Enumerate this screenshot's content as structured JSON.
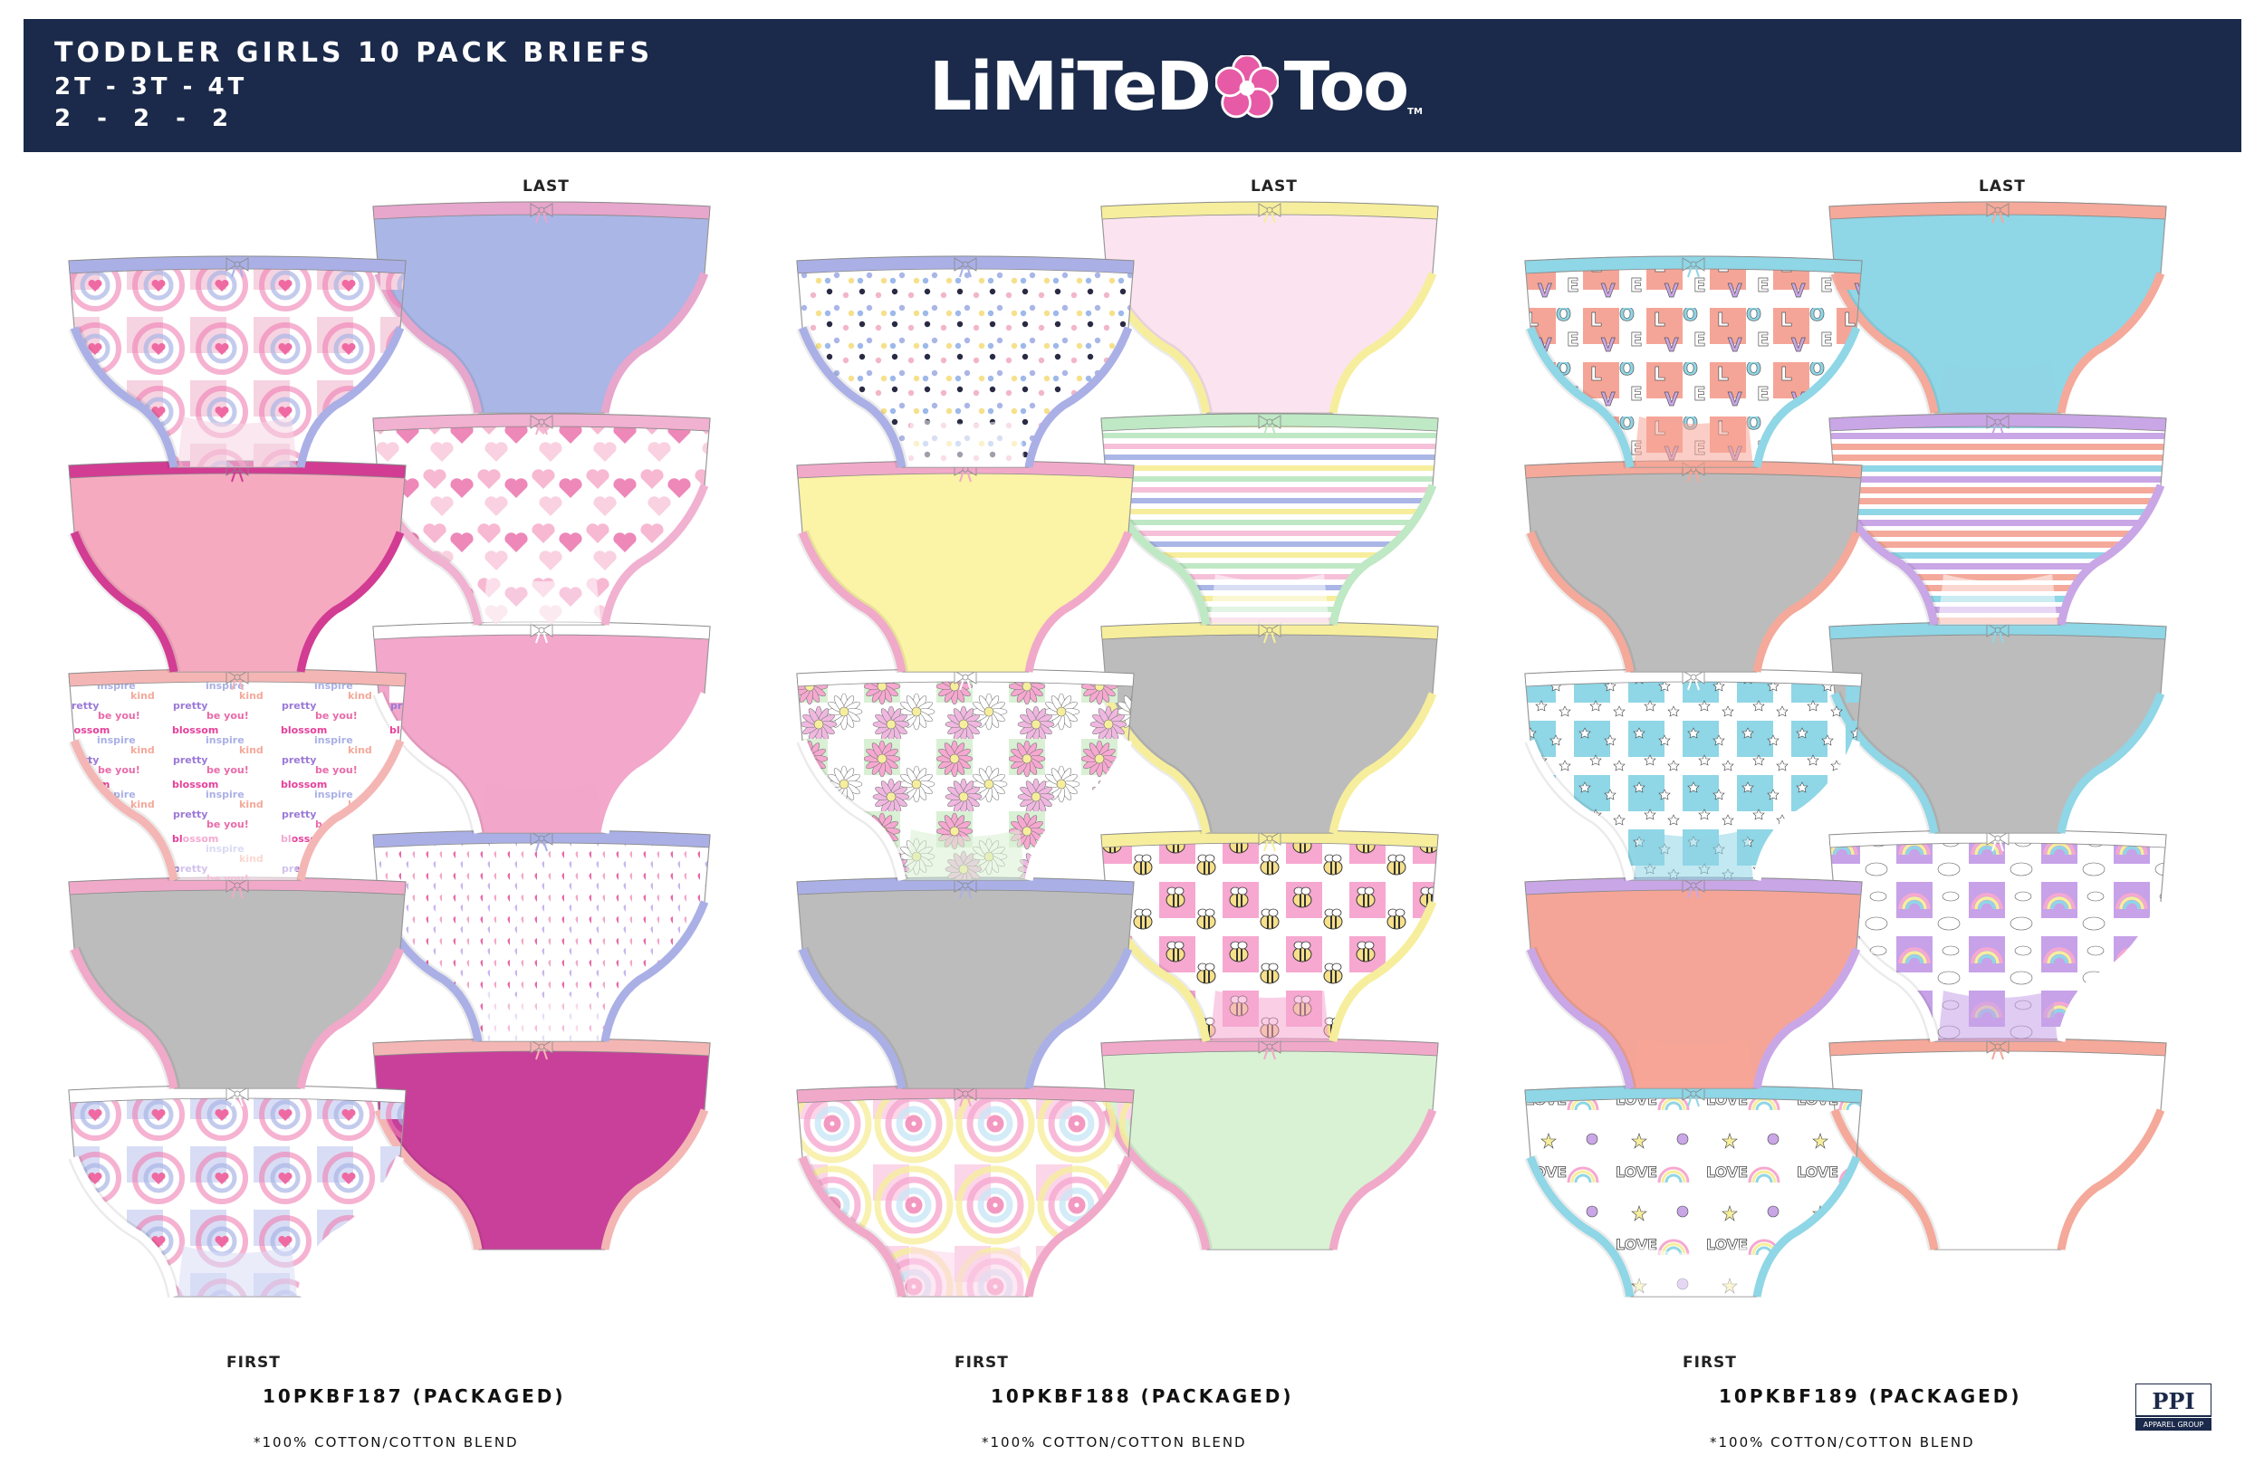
{
  "header": {
    "title": "TODDLER GIRLS 10 PACK BRIEFS",
    "sizes": "2T - 3T - 4T",
    "quantities": "2 - 2 - 2",
    "background_color": "#1b2a4a"
  },
  "logo": {
    "part1": "LiMiTeD",
    "part2": "Too",
    "mark": "TM",
    "flower_color": "#e65aa6"
  },
  "columns": [
    {
      "last_label": "LAST",
      "first_label": "FIRST",
      "sku": "10PKBF187 (PACKAGED)",
      "fabric_note": "*100% COTTON/COTTON BLEND"
    },
    {
      "last_label": "LAST",
      "first_label": "FIRST",
      "sku": "10PKBF188 (PACKAGED)",
      "fabric_note": "*100% COTTON/COTTON BLEND"
    },
    {
      "last_label": "LAST",
      "first_label": "FIRST",
      "sku": "10PKBF189 (PACKAGED)",
      "fabric_note": "*100% COTTON/COTTON BLEND"
    }
  ],
  "print_text_words": [
    "blossom",
    "inspire",
    "kind",
    "pretty",
    "be you!"
  ],
  "love_print_word": "LOVE",
  "briefs": [
    [
      {
        "pattern": "tiedye-hearts",
        "body": "#f6d3e1",
        "trim": "#aab0e6",
        "bow": "#aab0e6"
      },
      {
        "pattern": "solid",
        "body": "#aab6e6",
        "trim": "#e7a6cc",
        "bow": "#e7a6cc"
      },
      {
        "pattern": "solid",
        "body": "#f6aabf",
        "trim": "#d23c93",
        "bow": "#d23c93"
      },
      {
        "pattern": "scribble-hearts",
        "body": "#ffffff",
        "trim": "#f1b1d0",
        "bow": "#f1b1d0"
      },
      {
        "pattern": "text-print",
        "body": "#ffffff",
        "trim": "#f4b6b4",
        "bow": "#f4b6b4"
      },
      {
        "pattern": "solid",
        "body": "#f2a7cb",
        "trim": "#ffffff",
        "bow": "#ffffff"
      },
      {
        "pattern": "solid",
        "body": "#bcbcbc",
        "trim": "#f1a9c9",
        "bow": "#f1a9c9"
      },
      {
        "pattern": "small-hearts",
        "body": "#ffffff",
        "trim": "#aab0e6",
        "bow": "#aab0e6"
      },
      {
        "pattern": "tiedye-hearts",
        "body": "#d8ddf5",
        "trim": "#ffffff",
        "bow": "#ffffff"
      },
      {
        "pattern": "solid",
        "body": "#c9409a",
        "trim": "#f4b6b4",
        "bow": "#f4b6b4"
      }
    ],
    [
      {
        "pattern": "dots",
        "body": "#ffffff",
        "trim": "#aab0e6",
        "bow": "#aab0e6"
      },
      {
        "pattern": "solid",
        "body": "#fbe3ef",
        "trim": "#f6ee9c",
        "bow": "#f6ee9c"
      },
      {
        "pattern": "solid",
        "body": "#fbf3a6",
        "trim": "#f1a9c9",
        "bow": "#f1a9c9"
      },
      {
        "pattern": "stripes-pastel",
        "body": "#ffffff",
        "trim": "#bfe8c4",
        "bow": "#bfe8c4"
      },
      {
        "pattern": "daisies",
        "body": "#d9f0d4",
        "trim": "#ffffff",
        "bow": "#ffffff"
      },
      {
        "pattern": "solid",
        "body": "#bcbcbc",
        "trim": "#f6ee9c",
        "bow": "#f6ee9c"
      },
      {
        "pattern": "solid",
        "body": "#bcbcbc",
        "trim": "#aab0e6",
        "bow": "#aab0e6"
      },
      {
        "pattern": "bees",
        "body": "#f6a8d0",
        "trim": "#f6ee9c",
        "bow": "#f6ee9c"
      },
      {
        "pattern": "tiedye",
        "body": "#fbd6e9",
        "trim": "#f1a9c9",
        "bow": "#f1a9c9"
      },
      {
        "pattern": "solid",
        "body": "#d9f2d4",
        "trim": "#f1a9c9",
        "bow": "#f1a9c9"
      }
    ],
    [
      {
        "pattern": "love-letters",
        "body": "#f5a597",
        "trim": "#8fd6e6",
        "bow": "#8fd6e6"
      },
      {
        "pattern": "solid",
        "body": "#8fd6e6",
        "trim": "#f4a99a",
        "bow": "#f4a99a"
      },
      {
        "pattern": "solid",
        "body": "#bcbcbc",
        "trim": "#f4a99a",
        "bow": "#f4a99a"
      },
      {
        "pattern": "stripes-coral",
        "body": "#ffffff",
        "trim": "#c9a6e6",
        "bow": "#c9a6e6"
      },
      {
        "pattern": "stars",
        "body": "#8fd6e6",
        "trim": "#ffffff",
        "bow": "#ffffff"
      },
      {
        "pattern": "solid",
        "body": "#bcbcbc",
        "trim": "#8fd6e6",
        "bow": "#8fd6e6"
      },
      {
        "pattern": "solid",
        "body": "#f5a597",
        "trim": "#c9a6e6",
        "bow": "#c9a6e6"
      },
      {
        "pattern": "rainbows",
        "body": "#c7a2e8",
        "trim": "#ffffff",
        "bow": "#ffffff"
      },
      {
        "pattern": "unicorns",
        "body": "#ffffff",
        "trim": "#8fd6e6",
        "bow": "#8fd6e6"
      },
      {
        "pattern": "solid",
        "body": "#ffffff",
        "trim": "#f4a99a",
        "bow": "#f4a99a"
      }
    ]
  ],
  "ppi_logo": {
    "text": "PPI",
    "subtext": "APPAREL GROUP"
  }
}
